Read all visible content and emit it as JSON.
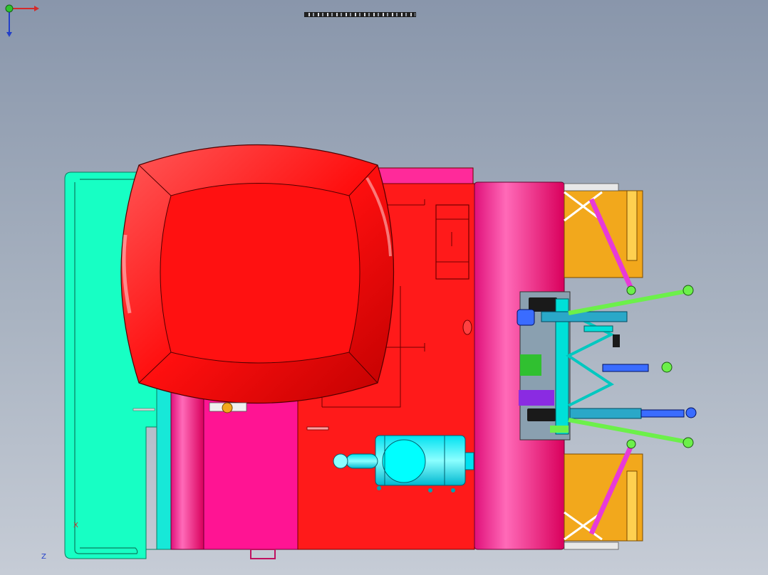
{
  "window": {
    "title_strip": "................................"
  },
  "triad": {
    "x_label": "X",
    "z_label": "Z"
  },
  "colors": {
    "background_top": "#8996ab",
    "background_bottom": "#c6ccd6",
    "seat_red": "#ff1414",
    "body_red": "#ff1a1a",
    "body_pink": "#ff1493",
    "front_magenta": "#e8208a",
    "side_teal": "#17ffc4",
    "aqua_parts": "#00f0ff",
    "weight_orange": "#f2a81c",
    "link_green": "#6cf04a",
    "link_magenta": "#e83ad8",
    "pin_blue": "#3a6cff",
    "purple": "#8a2be2"
  },
  "icons": [
    "coordinate-triad-icon"
  ]
}
